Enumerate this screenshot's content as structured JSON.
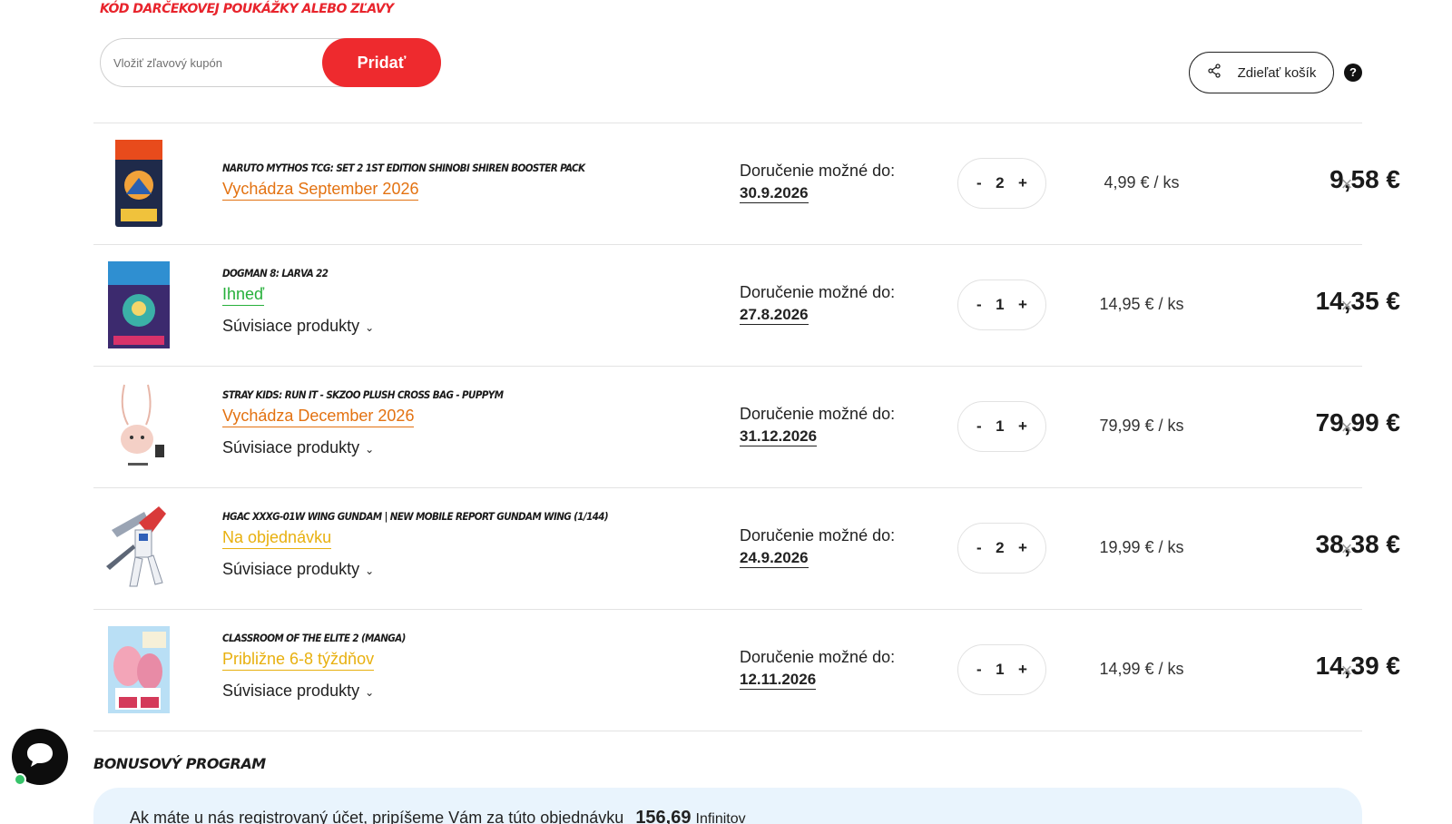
{
  "coupon": {
    "title": "Kód darčekovej poukážky alebo zľavy",
    "placeholder": "Vložiť zľavový kupón",
    "add_label": "Pridať"
  },
  "share": {
    "label": "Zdieľať košík"
  },
  "help": {
    "label": "?"
  },
  "cart": {
    "delivery_label": "Doručenie možné do:",
    "related_label": "Súvisiace produkty",
    "items": [
      {
        "name": "Naruto Mythos TCG: Set 2 1st Edition Shinobi Shiren Booster Pack",
        "availability": "Vychádza September 2026",
        "availability_color": "#e37211",
        "has_related": false,
        "delivery_date": "30.9.2026",
        "qty": "2",
        "unit_price": "4,99 € / ks",
        "total": "9,58 €"
      },
      {
        "name": "Dogman 8: Larva 22",
        "availability": "Ihneď",
        "availability_color": "#27b03b",
        "has_related": true,
        "delivery_date": "27.8.2026",
        "qty": "1",
        "unit_price": "14,95 € / ks",
        "total": "14,35 €"
      },
      {
        "name": "Stray Kids: Run It - SKZOO Plush Cross Bag - PuppyM",
        "availability": "Vychádza December 2026",
        "availability_color": "#e37211",
        "has_related": true,
        "delivery_date": "31.12.2026",
        "qty": "1",
        "unit_price": "79,99 € / ks",
        "total": "79,99 €"
      },
      {
        "name": "HGAC XXXG-01W Wing Gundam | New Mobile Report Gundam Wing (1/144)",
        "availability": "Na objednávku",
        "availability_color": "#e8b00f",
        "has_related": true,
        "delivery_date": "24.9.2026",
        "qty": "2",
        "unit_price": "19,99 € / ks",
        "total": "38,38 €"
      },
      {
        "name": "Classroom of the Elite 2 (manga)",
        "availability": "Približne 6-8 týždňov",
        "availability_color": "#e8b00f",
        "has_related": true,
        "delivery_date": "12.11.2026",
        "qty": "1",
        "unit_price": "14,99 € / ks",
        "total": "14,39 €"
      }
    ]
  },
  "bonus": {
    "title": "Bonusový program",
    "text_before": "Ak máte u nás ",
    "link": "registrovaný účet",
    "text_after": ", pripíšeme Vám za túto objednávku",
    "points": "156,69",
    "points_unit": "Infinitov"
  },
  "icons": {
    "share": "share-icon",
    "help": "question-icon",
    "remove": "close-icon",
    "chat": "chat-icon",
    "chevron": "chevron-down-icon"
  }
}
